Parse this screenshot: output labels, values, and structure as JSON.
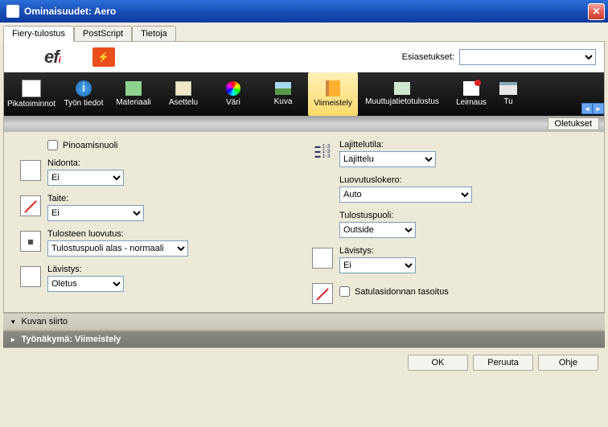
{
  "window": {
    "title": "Ominaisuudet: Aero"
  },
  "tabs": [
    "Fiery-tulostus",
    "PostScript",
    "Tietoja"
  ],
  "presets": {
    "label": "Esiasetukset:",
    "value": ""
  },
  "toolbar": {
    "items": [
      {
        "label": "Pikatoiminnot"
      },
      {
        "label": "Työn tiedot"
      },
      {
        "label": "Materiaali"
      },
      {
        "label": "Asettelu"
      },
      {
        "label": "Väri"
      },
      {
        "label": "Kuva"
      },
      {
        "label": "Viimeistely"
      },
      {
        "label": "Muuttujatietotulostus"
      },
      {
        "label": "Leimaus"
      },
      {
        "label": "Tu"
      }
    ],
    "defaults": "Oletukset"
  },
  "form": {
    "stacking_arrow": "Pinoamisnuoli",
    "stapling": {
      "label": "Nidonta:",
      "value": "Ei"
    },
    "fold": {
      "label": "Taite:",
      "value": "Ei"
    },
    "output_delivery": {
      "label": "Tulosteen luovutus:",
      "value": "Tulostuspuoli alas - normaali"
    },
    "punch_left": {
      "label": "Lävistys:",
      "value": "Oletus"
    },
    "sort_mode": {
      "label": "Lajittelutila:",
      "value": "Lajittelu"
    },
    "output_tray": {
      "label": "Luovutuslokero:",
      "value": "Auto"
    },
    "print_side": {
      "label": "Tulostuspuoli:",
      "value": "Outside"
    },
    "punch_right": {
      "label": "Lävistys:",
      "value": "Ei"
    },
    "saddle_comp": "Satulasidonnan tasoitus"
  },
  "accordion": {
    "image_shift": "Kuvan siirto",
    "job_view": "Työnäkymä: Viimeistely"
  },
  "buttons": {
    "ok": "OK",
    "cancel": "Peruuta",
    "help": "Ohje"
  }
}
